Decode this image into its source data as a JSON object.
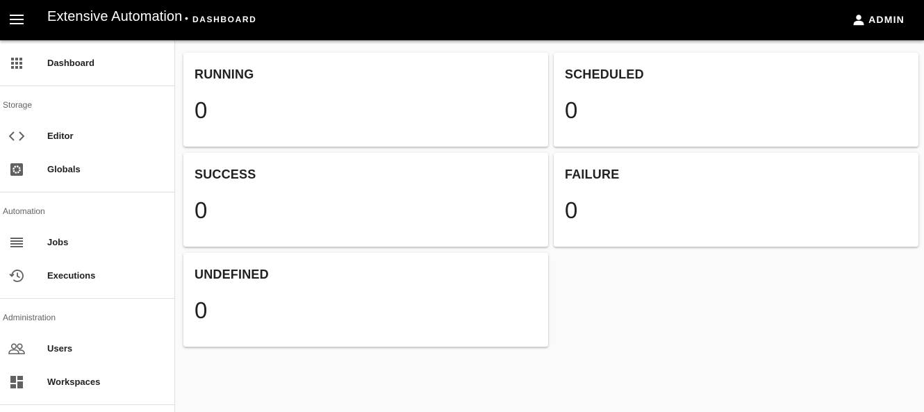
{
  "header": {
    "app_title": "Extensive Automation",
    "separator": "•",
    "page_name": "DASHBOARD",
    "user_label": "ADMIN"
  },
  "sidebar": {
    "dashboard": {
      "label": "Dashboard",
      "icon": "apps-grid-icon"
    },
    "sections": [
      {
        "header": "Storage",
        "items": [
          {
            "label": "Editor",
            "icon": "code-icon"
          },
          {
            "label": "Globals",
            "icon": "settings-box-icon"
          }
        ]
      },
      {
        "header": "Automation",
        "items": [
          {
            "label": "Jobs",
            "icon": "list-icon"
          },
          {
            "label": "Executions",
            "icon": "history-icon"
          }
        ]
      },
      {
        "header": "Administration",
        "items": [
          {
            "label": "Users",
            "icon": "people-icon"
          },
          {
            "label": "Workspaces",
            "icon": "dashboard-tiles-icon"
          }
        ]
      }
    ]
  },
  "cards": [
    {
      "title": "RUNNING",
      "value": "0"
    },
    {
      "title": "SCHEDULED",
      "value": "0"
    },
    {
      "title": "SUCCESS",
      "value": "0"
    },
    {
      "title": "FAILURE",
      "value": "0"
    },
    {
      "title": "UNDEFINED",
      "value": "0"
    }
  ],
  "colors": {
    "topbar": "#000000",
    "background": "#fafafa",
    "card": "#ffffff",
    "icon": "#616161",
    "text": "#212121"
  }
}
